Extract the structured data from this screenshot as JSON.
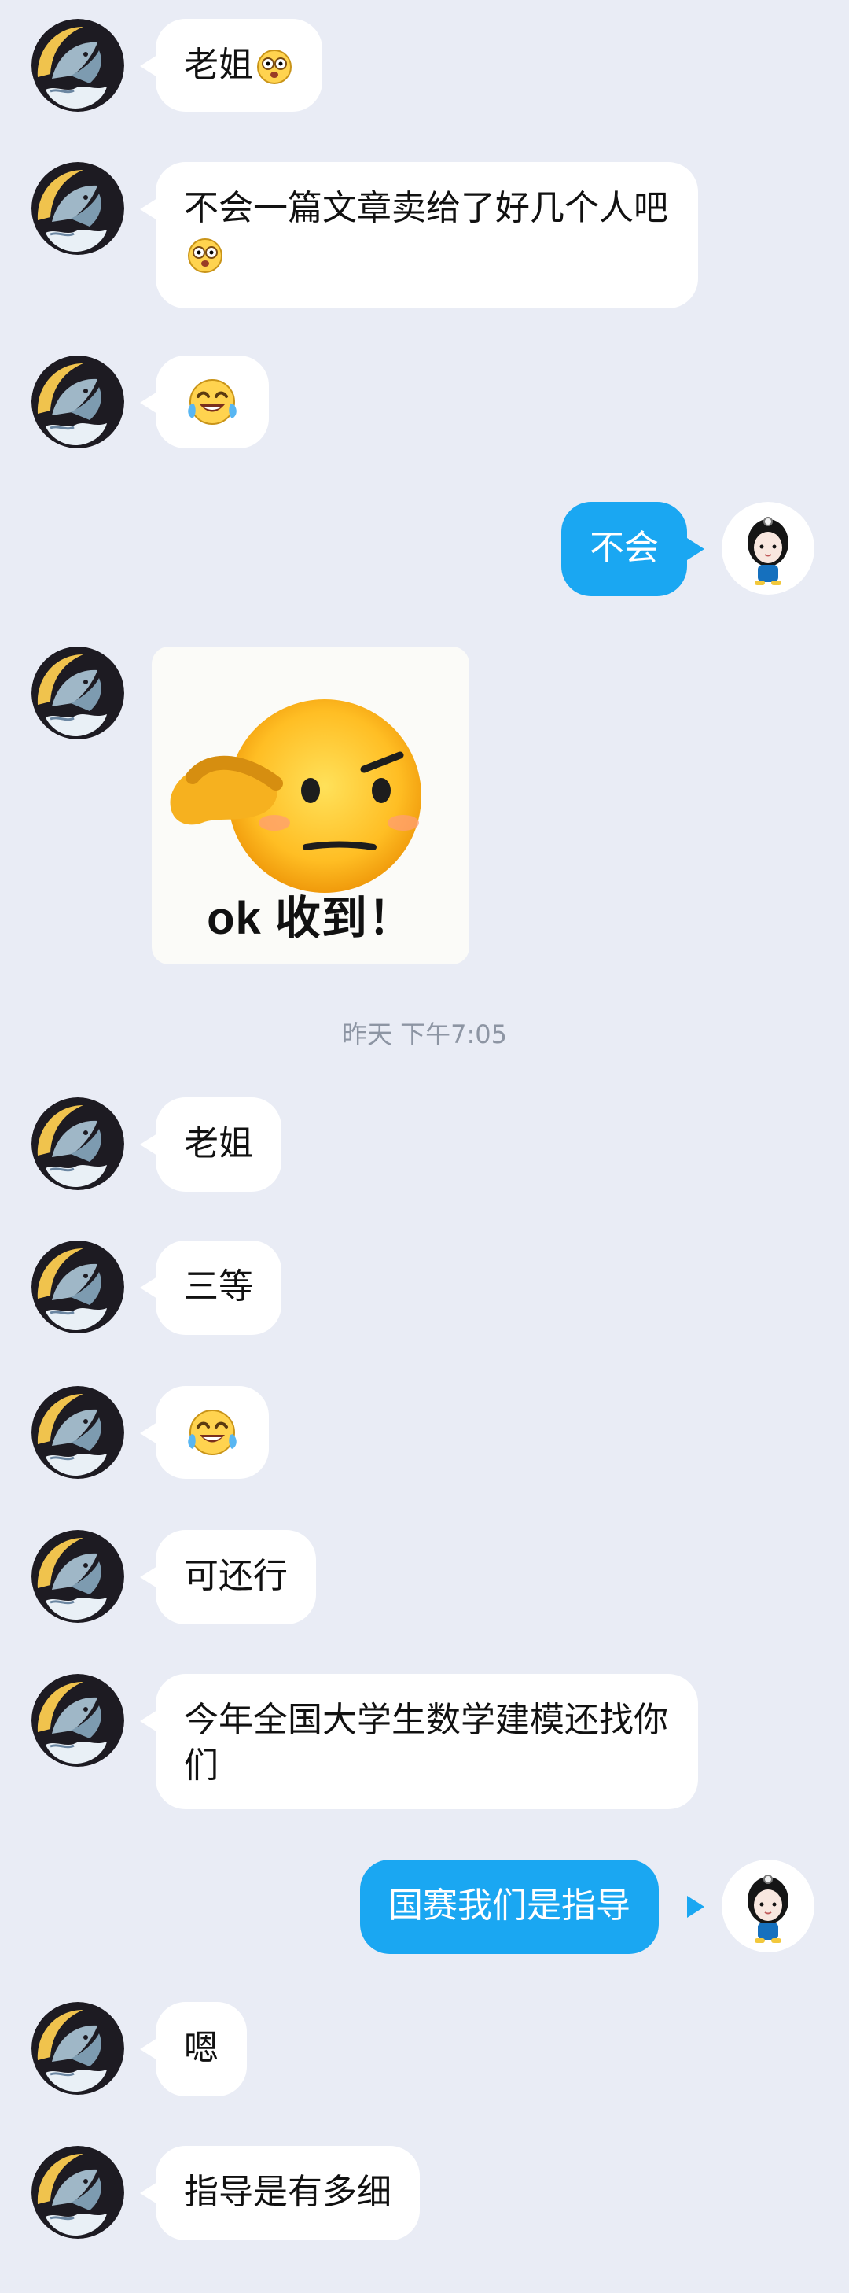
{
  "theme": {
    "background": "#e9ecf5",
    "incoming_bubble": "#ffffff",
    "outgoing_bubble": "#1aa7f2",
    "timestamp_color": "#8d95a3"
  },
  "contacts": {
    "incoming_avatar": "dolphin-avatar-icon",
    "outgoing_avatar": "girl-avatar-icon"
  },
  "messages": [
    {
      "side": "left",
      "text": "老姐",
      "emoji": "shocked-face-icon"
    },
    {
      "side": "left",
      "text": "不会一篇文章卖给了好几个人吧",
      "emoji": "shocked-face-icon"
    },
    {
      "side": "left",
      "text": "",
      "emoji": "laughing-tears-icon"
    },
    {
      "side": "right",
      "text": "不会"
    },
    {
      "side": "left",
      "type": "sticker",
      "sticker_text": "ok 收到！",
      "sticker_icon": "saluting-face-icon"
    },
    {
      "side": "left",
      "text": "老姐"
    },
    {
      "side": "left",
      "text": "三等"
    },
    {
      "side": "left",
      "text": "",
      "emoji": "laughing-tears-icon"
    },
    {
      "side": "left",
      "text": "可还行"
    },
    {
      "side": "left",
      "text": "今年全国大学生数学建模还找你们"
    },
    {
      "side": "right",
      "text": "国赛我们是指导"
    },
    {
      "side": "left",
      "text": "嗯"
    },
    {
      "side": "left",
      "text": "指导是有多细"
    }
  ],
  "timestamp": "昨天 下午7:05"
}
